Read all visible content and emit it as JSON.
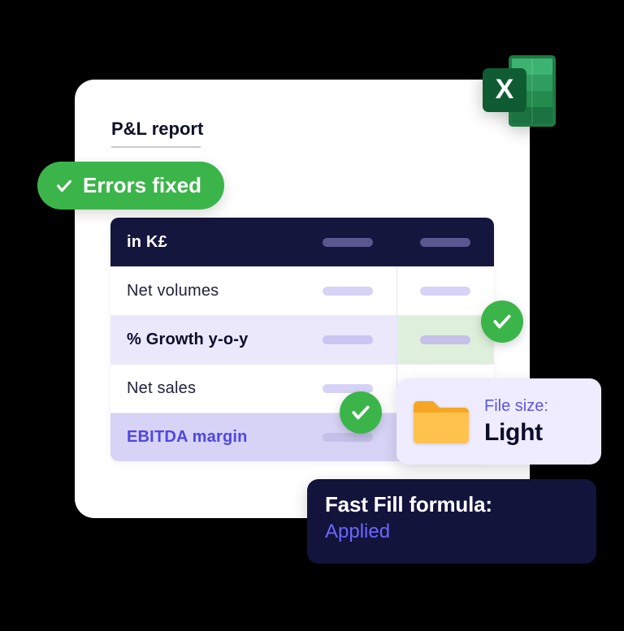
{
  "card": {
    "title": "P&L report"
  },
  "table": {
    "header_label": "in K£",
    "rows": [
      {
        "label": "Net volumes"
      },
      {
        "label": "% Growth y-o-y"
      },
      {
        "label": "Net sales"
      },
      {
        "label": "EBITDA margin"
      }
    ]
  },
  "badges": {
    "errors_fixed": "Errors fixed"
  },
  "file_size": {
    "label": "File size:",
    "value": "Light"
  },
  "fast_fill": {
    "label": "Fast Fill formula:",
    "value": "Applied"
  },
  "icons": {
    "excel": "excel-icon",
    "folder": "folder-icon",
    "check": "check-icon"
  }
}
